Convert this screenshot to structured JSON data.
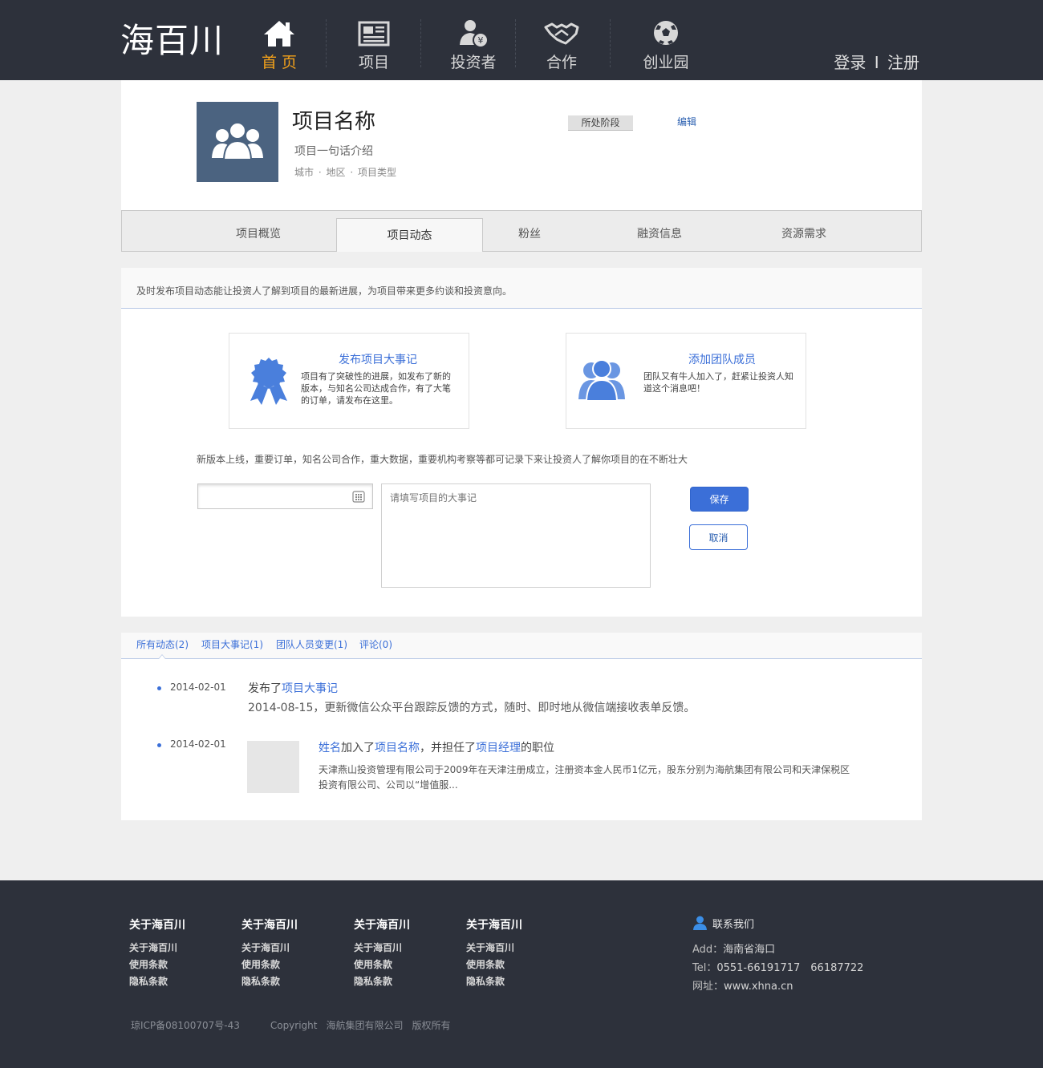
{
  "header": {
    "logo": "海百川",
    "nav": [
      {
        "label": "首 页",
        "icon": "home-icon",
        "active": true
      },
      {
        "label": "项目",
        "icon": "newspaper-icon",
        "active": false
      },
      {
        "label": "投资者",
        "icon": "investor-icon",
        "active": false
      },
      {
        "label": "合作",
        "icon": "handshake-icon",
        "active": false
      },
      {
        "label": "创业园",
        "icon": "soccer-ball-icon",
        "active": false
      }
    ],
    "login": "登录",
    "separator": "I",
    "register": "注册",
    "active_color": "#f4a21a"
  },
  "project": {
    "name": "项目名称",
    "intro": "项目一句话介绍",
    "city": "城市",
    "area": "地区",
    "type": "项目类型",
    "stage": "所处阶段",
    "edit": "编辑"
  },
  "tabs": [
    {
      "label": "项目概览",
      "active": false
    },
    {
      "label": "项目动态",
      "active": true
    },
    {
      "label": "粉丝",
      "active": false
    },
    {
      "label": "融资信息",
      "active": false
    },
    {
      "label": "资源需求",
      "active": false
    }
  ],
  "publish": {
    "tip": "及时发布项目动态能让投资人了解到项目的最新进展，为项目带来更多约谈和投资意向。",
    "cards": [
      {
        "title": "发布项目大事记",
        "desc": "项目有了突破性的进展，如发布了新的版本，与知名公司达成合作，有了大笔的订单，请发布在这里。",
        "icon": "award-ribbon-icon"
      },
      {
        "title": "添加团队成员",
        "desc": "团队又有牛人加入了，赶紧让投资人知道这个消息吧！",
        "icon": "team-members-icon"
      }
    ],
    "hint": "新版本上线，重要订单，知名公司合作，重大数据，重要机构考察等都可记录下来让投资人了解你项目的在不断壮大",
    "date_value": "",
    "textarea_placeholder": "请填写项目的大事记",
    "save": "保存",
    "cancel": "取消",
    "accent": "#3b6fd8"
  },
  "feed": {
    "tabs": [
      "所有动态(2)",
      "项目大事记(1)",
      "团队人员变更(1)",
      "评论(0)"
    ],
    "items": [
      {
        "date": "2014-02-01",
        "prefix": "发布了",
        "link": "项目大事记",
        "detail": "2014-08-15，更新微信公众平台跟踪反馈的方式，随时、即时地从微信端接收表单反馈。"
      },
      {
        "date": "2014-02-01",
        "person": "姓名",
        "joined": "加入了",
        "project": "项目名称",
        "role_prefix": "，并担任了",
        "role": "项目经理",
        "role_suffix": "的职位",
        "excerpt": "天津燕山投资管理有限公司于2009年在天津注册成立，注册资本金人民币1亿元，股东分别为海航集团有限公司和天津保税区投资有限公司、公司以“增值服..."
      }
    ]
  },
  "footer": {
    "columns": [
      {
        "heading": "关于海百川",
        "links": [
          "关于海百川",
          "使用条款",
          "隐私条款"
        ]
      },
      {
        "heading": "关于海百川",
        "links": [
          "关于海百川",
          "使用条款",
          "隐私条款"
        ]
      },
      {
        "heading": "关于海百川",
        "links": [
          "关于海百川",
          "使用条款",
          "隐私条款"
        ]
      },
      {
        "heading": "关于海百川",
        "links": [
          "关于海百川",
          "使用条款",
          "隐私条款"
        ]
      }
    ],
    "contact": {
      "heading": "联系我们",
      "add_label": "Add：",
      "add_value": "海南省海口",
      "tel_label": "Tel：",
      "tel_value": "0551-66191717　66187722",
      "web_label": "网址：",
      "web_value": "www.xhna.cn"
    },
    "icp": "琼ICP备08100707号-43",
    "copyright": "Copyright",
    "company": "海航集团有限公司",
    "rights": "版权所有"
  }
}
